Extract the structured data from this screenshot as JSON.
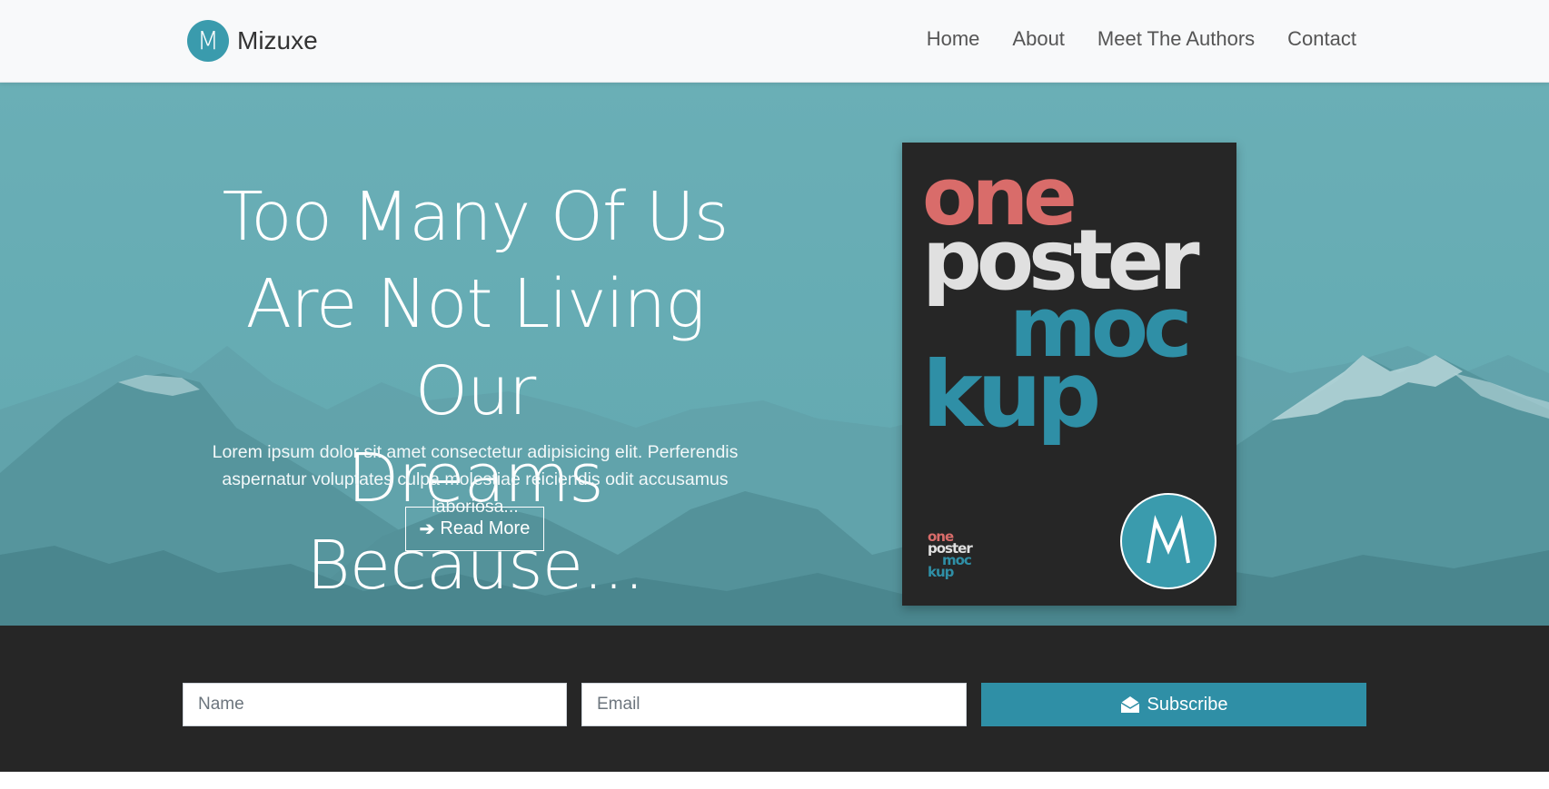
{
  "nav": {
    "brand_letter": "M",
    "brand_name": "Mizuxe",
    "links": [
      "Home",
      "About",
      "Meet The Authors",
      "Contact"
    ]
  },
  "hero": {
    "title_lines": [
      "Too Many Of Us",
      "Are Not Living Our",
      "Dreams Because..."
    ],
    "text_lines": [
      "Lorem ipsum dolor sit amet consectetur adipisicing elit. Perferendis",
      "aspernatur voluptates culpa molestiae reiciendis odit accusamus laboriosa..."
    ],
    "read_more_label": "Read More"
  },
  "poster": {
    "words": [
      "one",
      "poster",
      "moc",
      "kup"
    ],
    "badge_letter": "M"
  },
  "subscribe": {
    "name_placeholder": "Name",
    "email_placeholder": "Email",
    "button_label": "Subscribe"
  },
  "colors": {
    "accent": "#2f8fa6",
    "hero_bg": "#6aafb6",
    "dark_bg": "#262626",
    "poster_red": "#d96c6a"
  },
  "icons": {
    "read_more": "arrow-right-icon",
    "subscribe": "envelope-open-icon"
  }
}
